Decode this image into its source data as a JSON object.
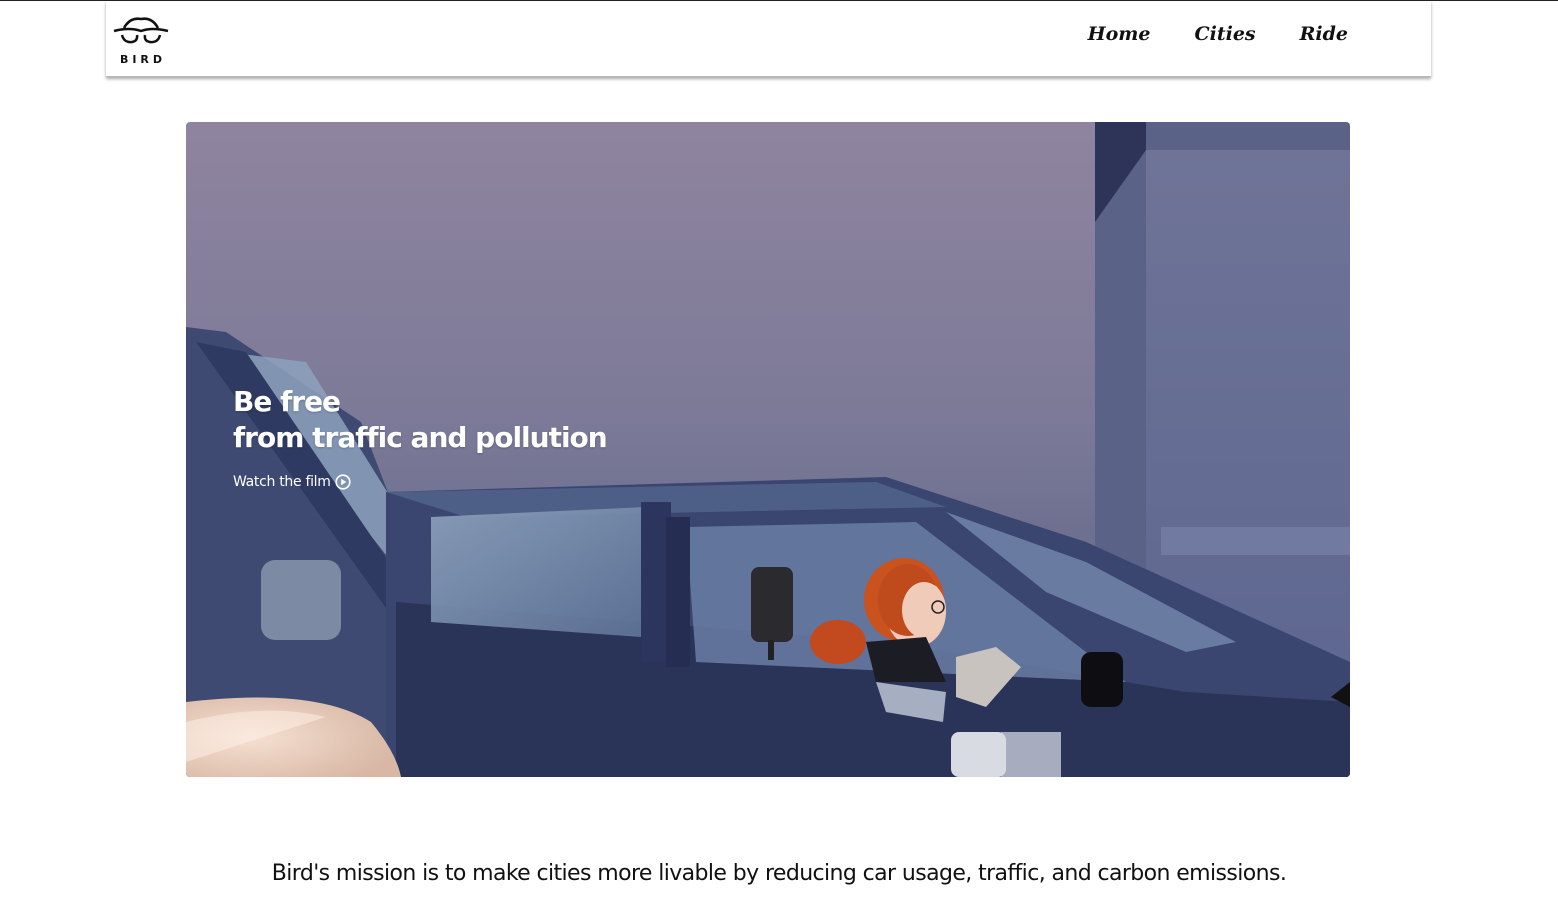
{
  "header": {
    "logo_text": "BIRD",
    "nav": [
      {
        "label": "Home"
      },
      {
        "label": "Cities"
      },
      {
        "label": "Ride"
      }
    ]
  },
  "hero": {
    "title_line1": "Be free",
    "title_line2": "from traffic and pollution",
    "watch_label": "Watch the film",
    "watch_icon": "play-circle-icon"
  },
  "mission": {
    "text": "Bird's mission is to make cities more livable by reducing car usage, traffic, and carbon emissions."
  },
  "colors": {
    "sky_top": "#8f849f",
    "sky_bottom": "#5a6185",
    "car_body": "#3a4570",
    "hair": "#c24a1e"
  }
}
